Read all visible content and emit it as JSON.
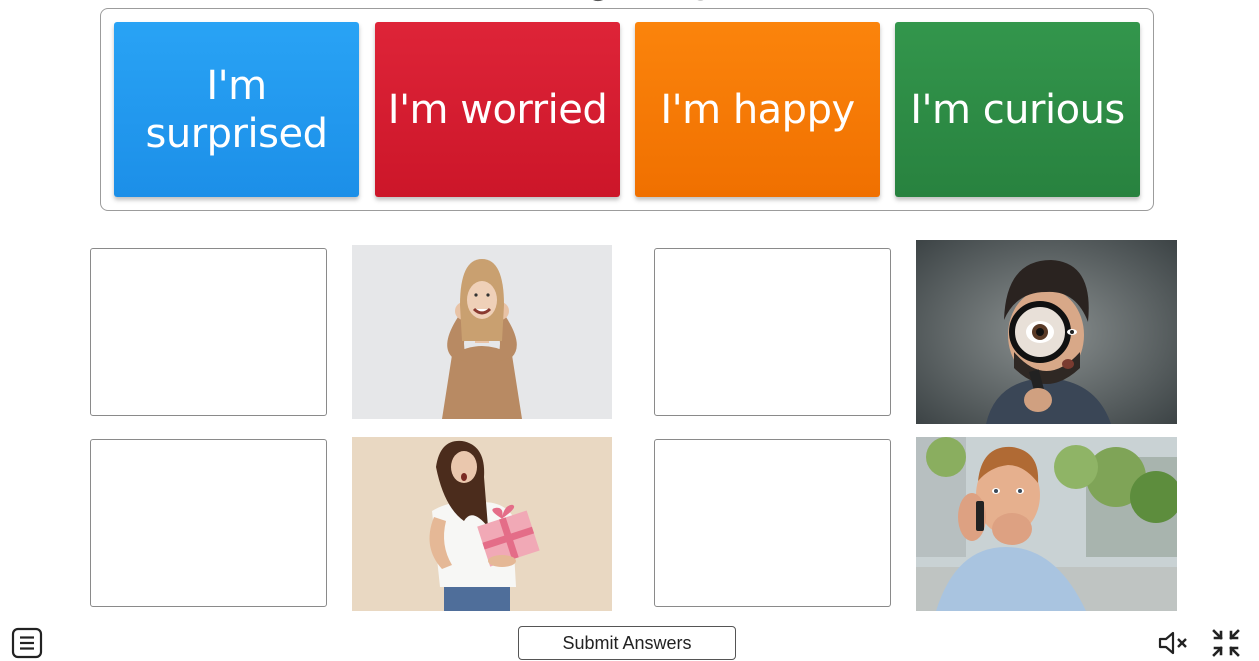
{
  "answer_tiles": [
    {
      "label": "I'm surprised",
      "color": "#2196f3"
    },
    {
      "label": "I'm worried",
      "color": "#d81b2e"
    },
    {
      "label": "I'm happy",
      "color": "#f57c00"
    },
    {
      "label": "I'm curious",
      "color": "#2e8b45"
    }
  ],
  "photos": [
    {
      "subject": "woman smiling with two thumbs up",
      "icon": "happy-woman-photo"
    },
    {
      "subject": "man with magnifying glass",
      "icon": "curious-man-photo"
    },
    {
      "subject": "woman holding pink gift box, surprised",
      "icon": "surprised-woman-photo"
    },
    {
      "subject": "man on phone biting nails",
      "icon": "worried-man-photo"
    }
  ],
  "footer": {
    "submit_label": "Submit Answers",
    "menu_icon": "menu-icon",
    "mute_icon": "sound-off-icon",
    "exit_fullscreen_icon": "exit-fullscreen-icon"
  }
}
